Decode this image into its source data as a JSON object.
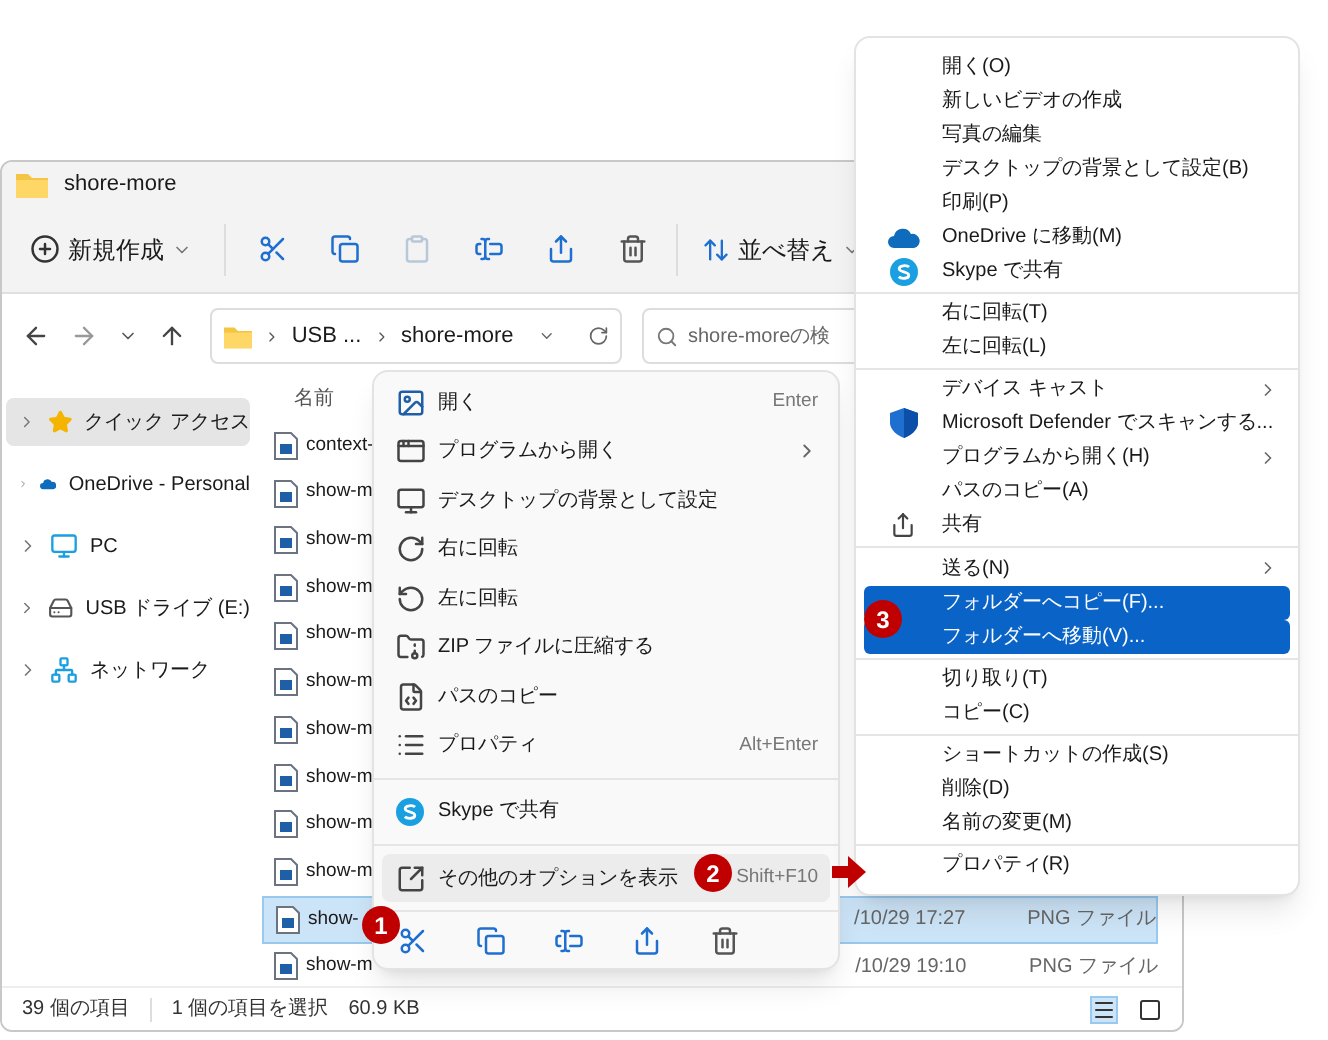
{
  "window": {
    "title": "shore-more"
  },
  "toolbar": {
    "new_label": "新規作成",
    "sort_label": "並べ替え"
  },
  "address": {
    "crumbs": [
      "USB ...",
      "shore-more"
    ]
  },
  "search": {
    "placeholder": "shore-moreの検"
  },
  "nav": [
    {
      "label": "クイック アクセス",
      "selected": true
    },
    {
      "label": "OneDrive - Personal",
      "selected": false
    },
    {
      "label": "PC",
      "selected": false
    },
    {
      "label": "USB ドライブ (E:)",
      "selected": false
    },
    {
      "label": "ネットワーク",
      "selected": false
    }
  ],
  "files": {
    "column": "名前",
    "rows": [
      {
        "name": "context-",
        "selected": false
      },
      {
        "name": "show-m",
        "selected": false
      },
      {
        "name": "show-m",
        "selected": false
      },
      {
        "name": "show-m",
        "selected": false
      },
      {
        "name": "show-m",
        "selected": false
      },
      {
        "name": "show-m",
        "selected": false
      },
      {
        "name": "show-m",
        "selected": false
      },
      {
        "name": "show-m",
        "selected": false
      },
      {
        "name": "show-m",
        "selected": false
      },
      {
        "name": "show-m",
        "selected": false
      },
      {
        "name": "show-",
        "selected": true,
        "date": "/10/29 17:27",
        "type": "PNG ファイル"
      },
      {
        "name": "show-m",
        "selected": false,
        "date": "/10/29 19:10",
        "type": "PNG ファイル"
      }
    ]
  },
  "status": {
    "count": "39 個の項目",
    "selection": "1 個の項目を選択",
    "size": "60.9 KB"
  },
  "context_menu": {
    "items": [
      {
        "kind": "item",
        "label": "開く",
        "shortcut": "Enter",
        "selected": false
      },
      {
        "kind": "item",
        "label": "プログラムから開く",
        "submenu": true,
        "selected": false
      },
      {
        "kind": "item",
        "label": "デスクトップの背景として設定",
        "selected": false
      },
      {
        "kind": "item",
        "label": "右に回転",
        "selected": false
      },
      {
        "kind": "item",
        "label": "左に回転",
        "selected": false
      },
      {
        "kind": "item",
        "label": "ZIP ファイルに圧縮する",
        "selected": false
      },
      {
        "kind": "item",
        "label": "パスのコピー",
        "selected": false
      },
      {
        "kind": "item",
        "label": "プロパティ",
        "shortcut": "Alt+Enter",
        "selected": false
      },
      {
        "kind": "separator"
      },
      {
        "kind": "item",
        "label": "Skype で共有",
        "selected": false
      },
      {
        "kind": "separator"
      },
      {
        "kind": "item",
        "label": "その他のオプションを表示",
        "shortcut": "Shift+F10",
        "selected": true
      },
      {
        "kind": "separator"
      },
      {
        "kind": "actions"
      }
    ]
  },
  "classic_menu": {
    "items": [
      {
        "kind": "item",
        "label": "開く(O)",
        "selected": false
      },
      {
        "kind": "item",
        "label": "新しいビデオの作成",
        "selected": false
      },
      {
        "kind": "item",
        "label": "写真の編集",
        "selected": false
      },
      {
        "kind": "item",
        "label": "デスクトップの背景として設定(B)",
        "selected": false
      },
      {
        "kind": "item",
        "label": "印刷(P)",
        "selected": false
      },
      {
        "kind": "item",
        "label": "OneDrive に移動(M)",
        "selected": false
      },
      {
        "kind": "item",
        "label": "Skype で共有",
        "selected": false
      },
      {
        "kind": "separator"
      },
      {
        "kind": "item",
        "label": "右に回転(T)",
        "selected": false
      },
      {
        "kind": "item",
        "label": "左に回転(L)",
        "selected": false
      },
      {
        "kind": "separator"
      },
      {
        "kind": "item",
        "label": "デバイス キャスト",
        "submenu": true,
        "selected": false
      },
      {
        "kind": "item",
        "label": "Microsoft Defender でスキャンする...",
        "selected": false
      },
      {
        "kind": "item",
        "label": "プログラムから開く(H)",
        "submenu": true,
        "selected": false
      },
      {
        "kind": "item",
        "label": "パスのコピー(A)",
        "selected": false
      },
      {
        "kind": "item",
        "label": "共有",
        "selected": false
      },
      {
        "kind": "separator"
      },
      {
        "kind": "item",
        "label": "送る(N)",
        "submenu": true,
        "selected": false
      },
      {
        "kind": "item",
        "label": "フォルダーへコピー(F)...",
        "selected": true
      },
      {
        "kind": "item",
        "label": "フォルダーへ移動(V)...",
        "selected": true
      },
      {
        "kind": "separator"
      },
      {
        "kind": "item",
        "label": "切り取り(T)",
        "selected": false
      },
      {
        "kind": "item",
        "label": "コピー(C)",
        "selected": false
      },
      {
        "kind": "separator"
      },
      {
        "kind": "item",
        "label": "ショートカットの作成(S)",
        "selected": false
      },
      {
        "kind": "item",
        "label": "削除(D)",
        "selected": false
      },
      {
        "kind": "item",
        "label": "名前の変更(M)",
        "selected": false
      },
      {
        "kind": "separator"
      },
      {
        "kind": "item",
        "label": "プロパティ(R)",
        "selected": false
      }
    ]
  },
  "callouts": [
    "1",
    "2",
    "3"
  ]
}
